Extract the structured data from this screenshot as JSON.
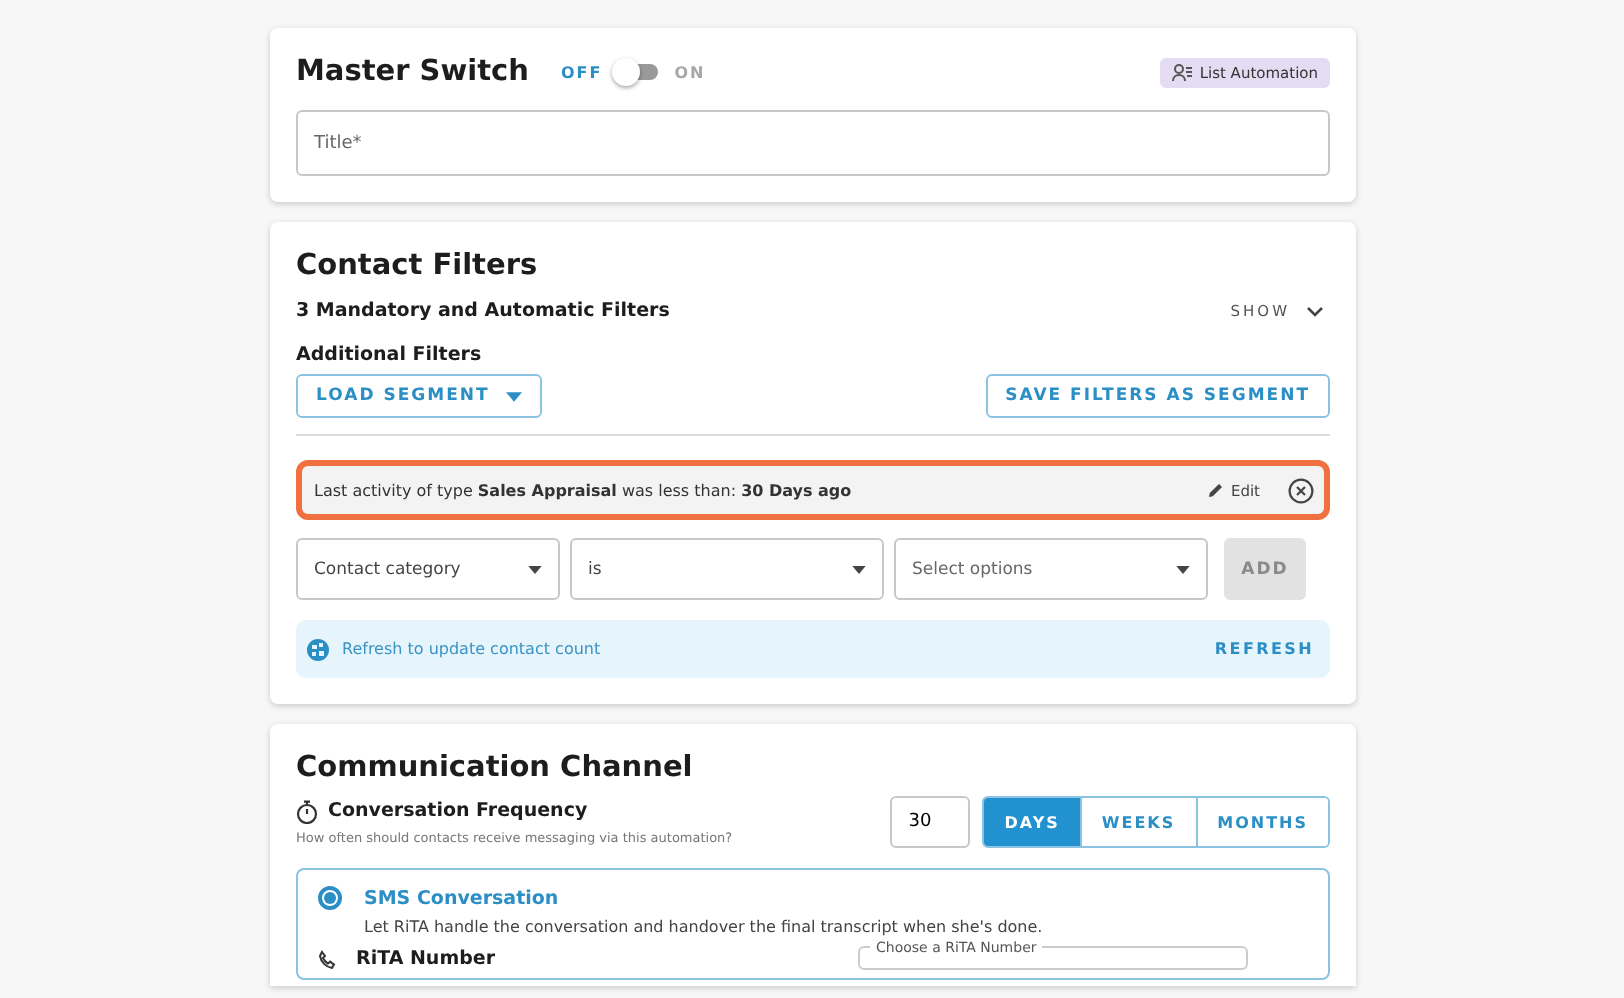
{
  "master_switch": {
    "title": "Master Switch",
    "toggle": {
      "off_label": "OFF",
      "on_label": "ON",
      "on": false
    },
    "badge": "List Automation",
    "title_field": {
      "placeholder": "Title*"
    }
  },
  "contact_filters": {
    "title": "Contact Filters",
    "mandatory": {
      "label": "3 Mandatory and Automatic Filters",
      "toggle_label": "SHOW",
      "expanded": false
    },
    "additional_label": "Additional Filters",
    "load_segment": "LOAD SEGMENT",
    "save_segment": "SAVE FILTERS AS SEGMENT",
    "active_filter": {
      "text": "Last activity of type **Sales Appraisal** was less than: **30 Days ago**",
      "edit": "Edit",
      "highlighted": true
    },
    "selects": [
      {
        "value": "Contact category"
      },
      {
        "value": "is"
      },
      {
        "placeholder": "Select options"
      }
    ],
    "add_button": {
      "label": "ADD",
      "disabled": true
    },
    "refresh_banner": {
      "message": "Refresh to update contact count",
      "action": "REFRESH"
    }
  },
  "communication_channel": {
    "title": "Communication Channel",
    "frequency": {
      "label": "Conversation Frequency",
      "hint": "How often should contacts receive messaging via this automation?",
      "value": "30",
      "units": [
        {
          "label": "DAYS",
          "selected": true
        },
        {
          "label": "WEEKS",
          "selected": false
        },
        {
          "label": "MONTHS",
          "selected": false
        }
      ]
    },
    "options": [
      {
        "title": "SMS Conversation",
        "description": "Let RiTA handle the conversation and handover the final transcript when she's done.",
        "selected": true,
        "number_label": "RiTA Number",
        "number_field_label": "Choose a RiTA Number"
      }
    ]
  }
}
